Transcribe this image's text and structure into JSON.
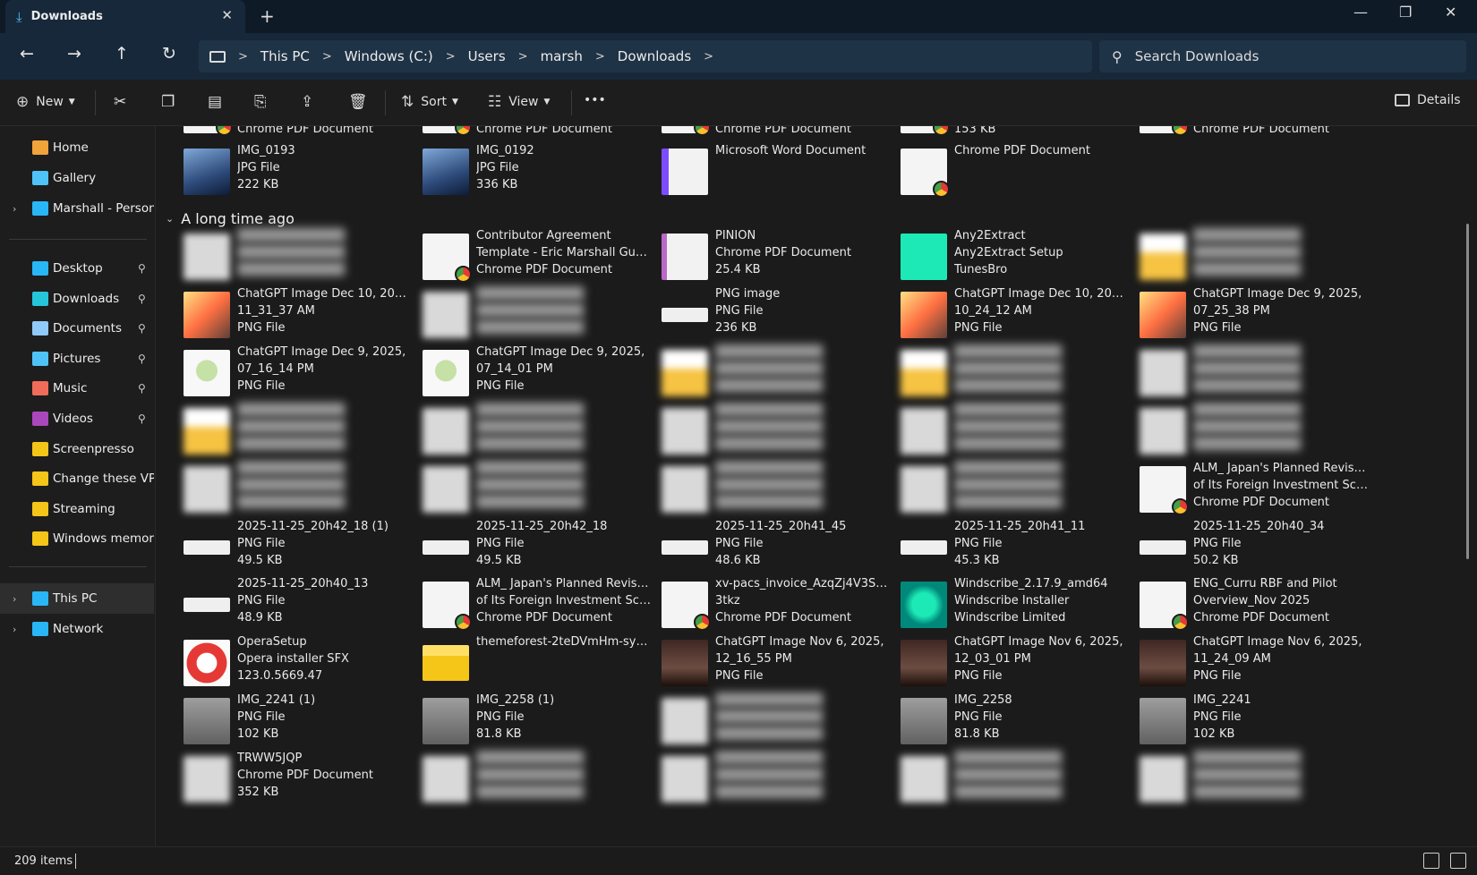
{
  "window": {
    "tab_title": "Downloads",
    "new_tab": "+",
    "controls": {
      "minimize": "—",
      "maximize": "❐",
      "close": "✕"
    }
  },
  "nav": {
    "back": "←",
    "forward": "→",
    "up": "↑",
    "refresh": "↻"
  },
  "breadcrumb": {
    "items": [
      "This PC",
      "Windows (C:)",
      "Users",
      "marsh",
      "Downloads"
    ],
    "separator": ">"
  },
  "search": {
    "placeholder": "Search Downloads"
  },
  "toolbar": {
    "new_label": "New",
    "sort_label": "Sort",
    "view_label": "View",
    "more_label": "•••",
    "details_label": "Details"
  },
  "sidebar": {
    "top": [
      {
        "label": "Home",
        "icon": "home-icon",
        "color": "#f2a33a"
      },
      {
        "label": "Gallery",
        "icon": "gallery-icon",
        "color": "#4fc3f7"
      },
      {
        "label": "Marshall - Personal",
        "icon": "cloud-icon",
        "color": "#29b6f6",
        "chevron": true
      }
    ],
    "pinned": [
      {
        "label": "Desktop",
        "icon": "desktop-icon",
        "color": "#29b6f6",
        "pinned": true
      },
      {
        "label": "Downloads",
        "icon": "downloads-icon",
        "color": "#26c6da",
        "pinned": true
      },
      {
        "label": "Documents",
        "icon": "documents-icon",
        "color": "#90caf9",
        "pinned": true
      },
      {
        "label": "Pictures",
        "icon": "pictures-icon",
        "color": "#4fc3f7",
        "pinned": true
      },
      {
        "label": "Music",
        "icon": "music-icon",
        "color": "#ef6c5a",
        "pinned": true
      },
      {
        "label": "Videos",
        "icon": "videos-icon",
        "color": "#ab47bc",
        "pinned": true
      },
      {
        "label": "Screenpresso",
        "icon": "folder-icon",
        "color": "#f5c518"
      },
      {
        "label": "Change these VPN s",
        "icon": "folder-icon",
        "color": "#f5c518"
      },
      {
        "label": "Streaming",
        "icon": "folder-icon",
        "color": "#f5c518"
      },
      {
        "label": "Windows memory d",
        "icon": "folder-icon",
        "color": "#f5c518"
      }
    ],
    "bottom": [
      {
        "label": "This PC",
        "icon": "pc-icon",
        "color": "#29b6f6",
        "chevron": true,
        "selected": true
      },
      {
        "label": "Network",
        "icon": "network-icon",
        "color": "#29b6f6",
        "chevron": true
      }
    ]
  },
  "group_header": "A long time ago",
  "top_rows": [
    [
      {
        "l1": "Chrome PDF Document",
        "thumb": "pdf"
      },
      {
        "l1": "Chrome PDF Document",
        "thumb": "pdf"
      },
      {
        "l1": "Chrome PDF Document",
        "thumb": "pdf"
      },
      {
        "l1": "153 KB",
        "thumb": "pdf"
      },
      {
        "l1": "Chrome PDF Document",
        "thumb": "pdf"
      }
    ],
    [
      {
        "l1": "IMG_0193",
        "l2": "JPG File",
        "l3": "222 KB",
        "thumb": "jpg"
      },
      {
        "l1": "IMG_0192",
        "l2": "JPG File",
        "l3": "336 KB",
        "thumb": "jpg"
      },
      {
        "l1": "",
        "l2": "",
        "l3": "Microsoft Word Document",
        "thumb": "word",
        "blur": true
      },
      {
        "l1": "",
        "l2": "",
        "l3": "Chrome PDF Document",
        "thumb": "pdf",
        "blur": true
      },
      null
    ]
  ],
  "rows": [
    [
      {
        "thumb": "blur",
        "blur": true
      },
      {
        "l1": "Contributor Agreement",
        "l2": "Template - Eric Marshall Gunn...",
        "l3": "Chrome PDF Document",
        "thumb": "pdf"
      },
      {
        "l1": "PINION",
        "l2": "Chrome PDF Document",
        "l3": "25.4 KB",
        "thumb": "pinion"
      },
      {
        "l1": "Any2Extract",
        "l2": "Any2Extract Setup",
        "l3": "TunesBro",
        "thumb": "a2e"
      },
      {
        "thumb": "blur-y",
        "blur": true
      }
    ],
    [
      {
        "l1": "ChatGPT Image Dec 10, 2025,",
        "l2": "11_31_37 AM",
        "l3": "PNG File",
        "thumb": "game"
      },
      {
        "thumb": "blur",
        "blur": true
      },
      {
        "l1": "PNG image",
        "l2": "PNG File",
        "l3": "236 KB",
        "thumb": "png-light"
      },
      {
        "l1": "ChatGPT Image Dec 10, 2025,",
        "l2": "10_24_12 AM",
        "l3": "PNG File",
        "thumb": "game"
      },
      {
        "l1": "ChatGPT Image Dec 9, 2025,",
        "l2": "07_25_38 PM",
        "l3": "PNG File",
        "thumb": "game"
      }
    ],
    [
      {
        "l1": "ChatGPT Image Dec 9, 2025,",
        "l2": "07_16_14 PM",
        "l3": "PNG File",
        "thumb": "soda"
      },
      {
        "l1": "ChatGPT Image Dec 9, 2025,",
        "l2": "07_14_01 PM",
        "l3": "PNG File",
        "thumb": "soda"
      },
      {
        "thumb": "blur-y",
        "blur": true
      },
      {
        "thumb": "blur-y",
        "blur": true
      },
      {
        "thumb": "blur",
        "blur": true
      }
    ],
    [
      {
        "thumb": "blur-y",
        "blur": true
      },
      {
        "thumb": "blur",
        "blur": true
      },
      {
        "thumb": "blur",
        "blur": true
      },
      {
        "thumb": "blur",
        "blur": true
      },
      {
        "thumb": "blur",
        "blur": true
      }
    ],
    [
      {
        "thumb": "blur",
        "blur": true
      },
      {
        "thumb": "blur",
        "blur": true
      },
      {
        "thumb": "blur",
        "blur": true
      },
      {
        "thumb": "blur",
        "blur": true
      },
      {
        "l1": "ALM_ Japan's Planned Revision",
        "l2": "of Its Foreign Investment Scr...",
        "l3": "Chrome PDF Document",
        "thumb": "pdf"
      }
    ],
    [
      {
        "l1": "2025-11-25_20h42_18 (1)",
        "l2": "PNG File",
        "l3": "49.5 KB",
        "thumb": "png-light"
      },
      {
        "l1": "2025-11-25_20h42_18",
        "l2": "PNG File",
        "l3": "49.5 KB",
        "thumb": "png-light"
      },
      {
        "l1": "2025-11-25_20h41_45",
        "l2": "PNG File",
        "l3": "48.6 KB",
        "thumb": "png-light"
      },
      {
        "l1": "2025-11-25_20h41_11",
        "l2": "PNG File",
        "l3": "45.3 KB",
        "thumb": "png-light"
      },
      {
        "l1": "2025-11-25_20h40_34",
        "l2": "PNG File",
        "l3": "50.2 KB",
        "thumb": "png-light"
      }
    ],
    [
      {
        "l1": "2025-11-25_20h40_13",
        "l2": "PNG File",
        "l3": "48.9 KB",
        "thumb": "png-light"
      },
      {
        "l1": "ALM_ Japan's Planned Revision",
        "l2": "of Its Foreign Investment Scr...",
        "l3": "Chrome PDF Document",
        "thumb": "pdf"
      },
      {
        "l1": "xv-pacs_invoice_AzqZj4V3S8zQ",
        "l2": "3tkz",
        "l3": "Chrome PDF Document",
        "thumb": "pdf"
      },
      {
        "l1": "Windscribe_2.17.9_amd64",
        "l2": "Windscribe Installer",
        "l3": "Windscribe Limited",
        "thumb": "ws"
      },
      {
        "l1": "ENG_Curru RBF and Pilot",
        "l2": "Overview_Nov 2025",
        "l3": "Chrome PDF Document",
        "thumb": "pdf"
      }
    ],
    [
      {
        "l1": "OperaSetup",
        "l2": "Opera installer SFX",
        "l3": "123.0.5669.47",
        "thumb": "opera"
      },
      {
        "l1": "themeforest-2teDVmHm-synas",
        "l2": "",
        "l3": "",
        "thumb": "folder",
        "blur2": true
      },
      {
        "l1": "ChatGPT Image Nov 6, 2025,",
        "l2": "12_16_55 PM",
        "l3": "PNG File",
        "thumb": "dark"
      },
      {
        "l1": "ChatGPT Image Nov 6, 2025,",
        "l2": "12_03_01 PM",
        "l3": "PNG File",
        "thumb": "dark"
      },
      {
        "l1": "ChatGPT Image Nov 6, 2025,",
        "l2": "11_24_09 AM",
        "l3": "PNG File",
        "thumb": "dark"
      }
    ],
    [
      {
        "l1": "IMG_2241 (1)",
        "l2": "PNG File",
        "l3": "102 KB",
        "thumb": "photo"
      },
      {
        "l1": "IMG_2258 (1)",
        "l2": "PNG File",
        "l3": "81.8 KB",
        "thumb": "photo"
      },
      {
        "thumb": "blur",
        "blur": true
      },
      {
        "l1": "IMG_2258",
        "l2": "PNG File",
        "l3": "81.8 KB",
        "thumb": "photo"
      },
      {
        "l1": "IMG_2241",
        "l2": "PNG File",
        "l3": "102 KB",
        "thumb": "photo"
      }
    ],
    [
      {
        "l1": "TRWW5JQP",
        "l2": "Chrome PDF Document",
        "l3": "352 KB",
        "thumb": "blur"
      },
      {
        "thumb": "blur",
        "blur": true
      },
      {
        "thumb": "blur",
        "blur": true
      },
      {
        "thumb": "blur",
        "blur": true
      },
      {
        "thumb": "blur",
        "blur": true
      }
    ]
  ],
  "status": {
    "item_count": "209 items"
  }
}
